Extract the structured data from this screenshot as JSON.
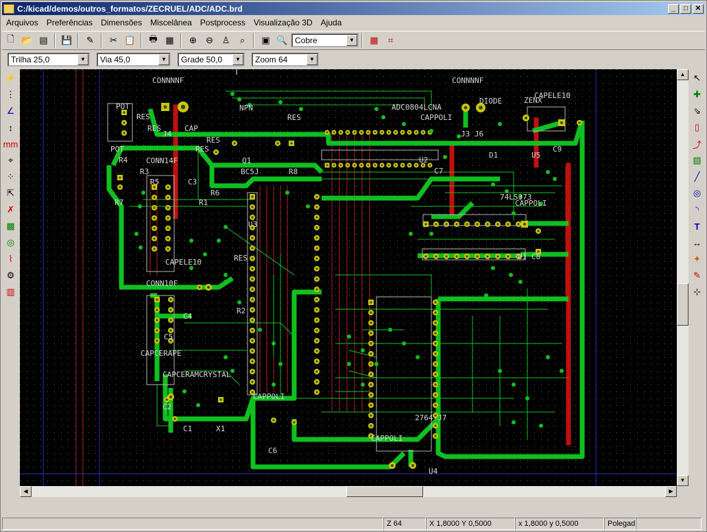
{
  "window": {
    "title": "C:/kicad/demos/outros_formatos/ZECRUEL/ADC/ADC.brd",
    "minimize": "_",
    "maximize": "□",
    "close": "✕"
  },
  "menu": [
    {
      "label": "Arquivos"
    },
    {
      "label": "Preferências"
    },
    {
      "label": "Dimensões"
    },
    {
      "label": "Miscelânea"
    },
    {
      "label": "Postprocess"
    },
    {
      "label": "Visualização 3D"
    },
    {
      "label": "Ajuda"
    }
  ],
  "toolbar": {
    "layer_select": "Cobre"
  },
  "toolbar2": {
    "track": "Trilha 25,0",
    "via": "Via 45,0",
    "grid": "Grade 50,0",
    "zoom": "Zoom 64"
  },
  "pcb_labels": {
    "conn1": "CONNNNF",
    "conn2": "CONNNNF",
    "pot": "POT",
    "pot2": "POT",
    "npn": "NPN",
    "res1": "RES",
    "res2": "RES",
    "res3": "RES",
    "res4": "RES",
    "res5": "RES",
    "res6": "RES",
    "cap": "CAP",
    "j4": "J4",
    "adc": "ADC0804LCNA",
    "cappoli1": "CAPPOLI",
    "diode": "DIODE",
    "zenx": "ZENX",
    "capele10a": "CAPELE10",
    "j3j6": "J3 J6",
    "c9": "C9",
    "u5": "U5",
    "d1": "D1",
    "u2": "U2",
    "c7": "C7",
    "r4": "R4",
    "conn14f": "CONN14F",
    "q1": "Q1",
    "bc": "BC5J",
    "r8": "R8",
    "r3": "R3",
    "r5": "R5",
    "c3": "C3",
    "r6": "R6",
    "r7": "R7",
    "r1": "R1",
    "u3": "U3",
    "ls373": "74LS373",
    "cappoli2": "CAPPOLI",
    "u1c8": "U1 C8",
    "capele10b": "CAPELE10",
    "conn10f": "CONN10F",
    "c4": "C4",
    "r2": "R2",
    "c5": "C5",
    "capcerape": "CAPCERAPE",
    "capcerx": "CAPCERAMCRYSTAL",
    "cappoli3": "CAPPOLI",
    "c2": "C2",
    "c1": "C1",
    "x1": "X1",
    "c6": "C6",
    "eprom": "2764-J7",
    "cappoli4": "CAPPOLI",
    "u4": "U4"
  },
  "status": {
    "zoom": "Z 64",
    "xy_abs": "X 1,8000  Y 0,5000",
    "xy_rel": "x 1,8000  y 0,5000",
    "units": "Polegad."
  },
  "colors": {
    "copper": "#10c020",
    "track_red": "#c01010",
    "pad": "#c8c800",
    "grid": "#3a6a3a"
  }
}
